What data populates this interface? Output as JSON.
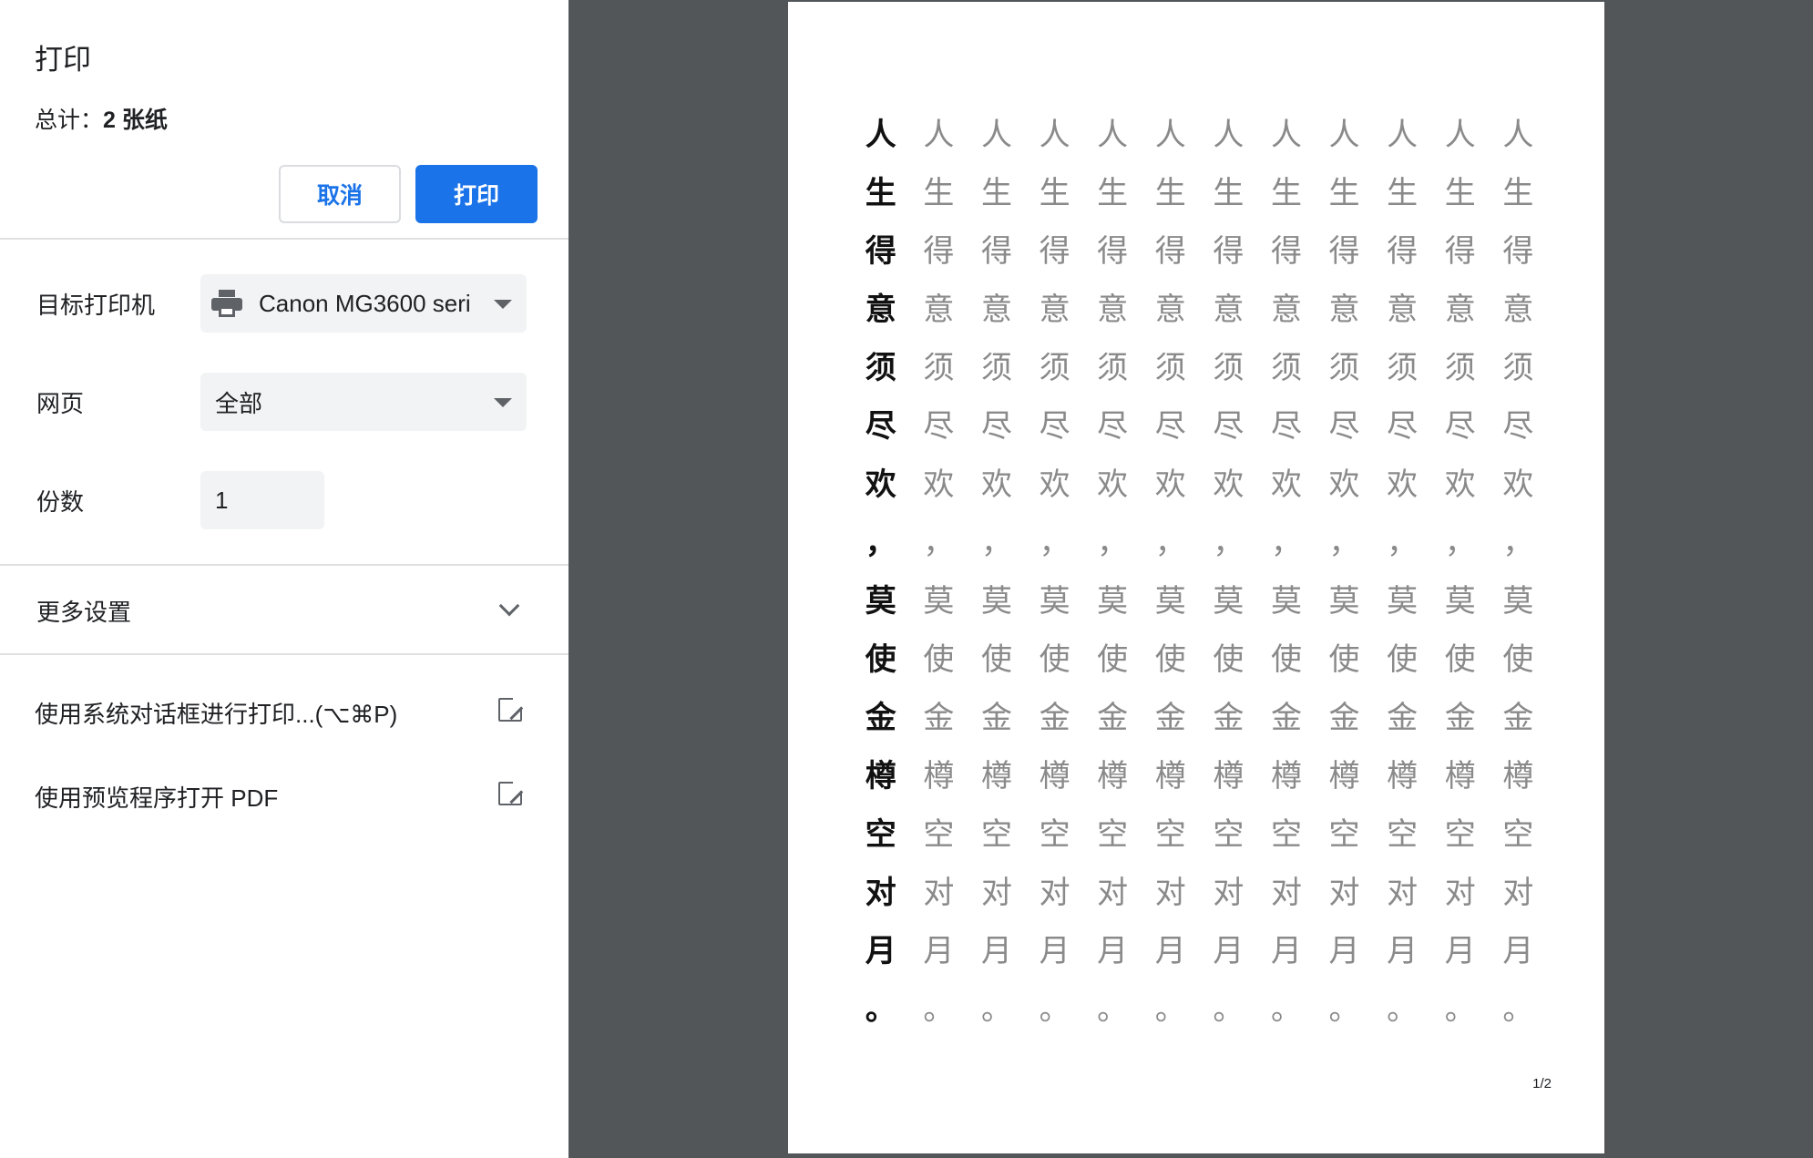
{
  "dialog": {
    "title": "打印",
    "total_label": "总计：",
    "total_value": "2 张纸",
    "cancel_label": "取消",
    "print_label": "打印"
  },
  "settings": {
    "printer_label": "目标打印机",
    "printer_value": "Canon MG3600 seri",
    "pages_label": "网页",
    "pages_value": "全部",
    "copies_label": "份数",
    "copies_value": "1",
    "more_settings_label": "更多设置"
  },
  "links": {
    "system_dialog": "使用系统对话框进行打印...(⌥⌘P)",
    "open_pdf": "使用预览程序打开 PDF"
  },
  "preview": {
    "characters": [
      "人",
      "生",
      "得",
      "意",
      "须",
      "尽",
      "欢",
      "，",
      "莫",
      "使",
      "金",
      "樽",
      "空",
      "对",
      "月",
      "。"
    ],
    "repeats_per_row": 12,
    "page_number": "1/2"
  },
  "icons": {
    "printer": "printer-icon",
    "dropdown": "caret-down-icon",
    "expand": "chevron-down-icon",
    "external": "open-in-new-icon"
  }
}
